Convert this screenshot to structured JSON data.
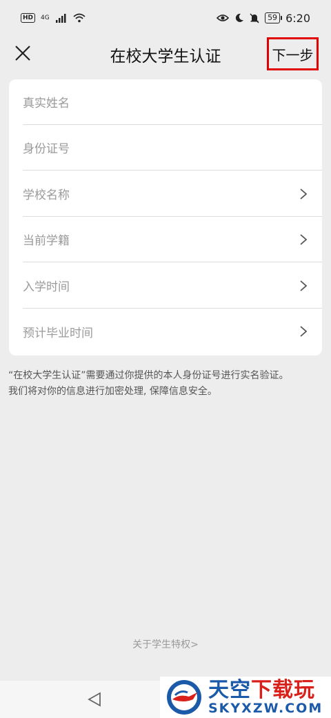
{
  "status_bar": {
    "hd": "HD",
    "network": "4G",
    "battery": "59",
    "time": "6:20"
  },
  "header": {
    "title": "在校大学生认证",
    "next_label": "下一步"
  },
  "form": {
    "rows": [
      {
        "label": "真实姓名",
        "has_chevron": false
      },
      {
        "label": "身份证号",
        "has_chevron": false
      },
      {
        "label": "学校名称",
        "has_chevron": true
      },
      {
        "label": "当前学籍",
        "has_chevron": true
      },
      {
        "label": "入学时间",
        "has_chevron": true
      },
      {
        "label": "预计毕业时间",
        "has_chevron": true
      }
    ]
  },
  "notice": {
    "line1": "“在校大学生认证”需要通过你提供的本人身份证号进行实名验证。",
    "line2": "我们将对你的信息进行加密处理, 保障信息安全。"
  },
  "footer": {
    "privilege_link": "关于学生特权>"
  },
  "watermark": {
    "title_blue": "天空",
    "title_red": "下载玩",
    "domain": "SKYXZW.COM"
  },
  "icons": {
    "close": "close-icon",
    "chevron": "chevron-right-icon",
    "back": "back-triangle-icon"
  }
}
